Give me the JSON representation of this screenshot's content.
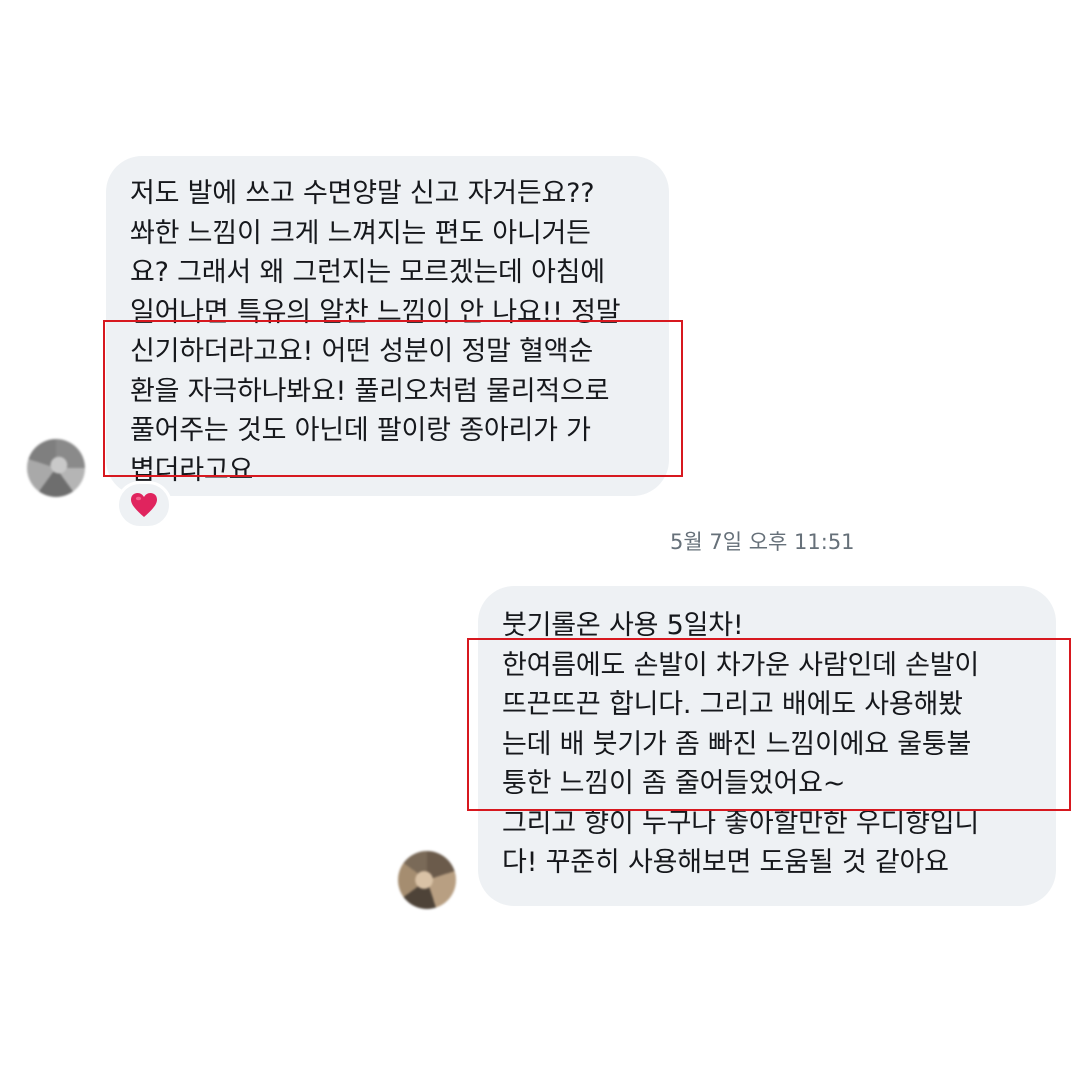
{
  "incoming_message": {
    "lines": [
      "저도 발에 쓰고 수면양말 신고 자거든요??",
      "쏴한 느낌이 크게 느껴지는 편도 아니거든",
      "요? 그래서 왜 그런지는 모르겠는데  아침에",
      "일어나면 특유의 알찬 느낌이 안 나요!! 정말",
      "신기하더라고요! 어떤 성분이 정말 혈액순",
      "환을 자극하나봐요! 풀리오처럼 물리적으로",
      "풀어주는 것도 아닌데 팔이랑 종아리가 가",
      "볍더라고요"
    ],
    "reaction": "❤️"
  },
  "timestamp": "5월 7일 오후 11:51",
  "outgoing_message": {
    "lines": [
      "붓기롤온 사용 5일차!",
      "한여름에도 손발이 차가운 사람인데 손발이",
      "뜨끈뜨끈 합니다. 그리고 배에도 사용해봤",
      "는데 배 붓기가 좀 빠진 느낌이에요 울퉁불",
      "퉁한 느낌이 좀 줄어들었어요~",
      "그리고 향이 누구나 좋아할만한 우디향입니",
      "다! 꾸준히 사용해보면 도움될 것 같아요"
    ]
  },
  "colors": {
    "bubble": "#eef1f4",
    "highlight": "#d7181f",
    "timestamp": "#667079",
    "heart": "#e0245e"
  }
}
